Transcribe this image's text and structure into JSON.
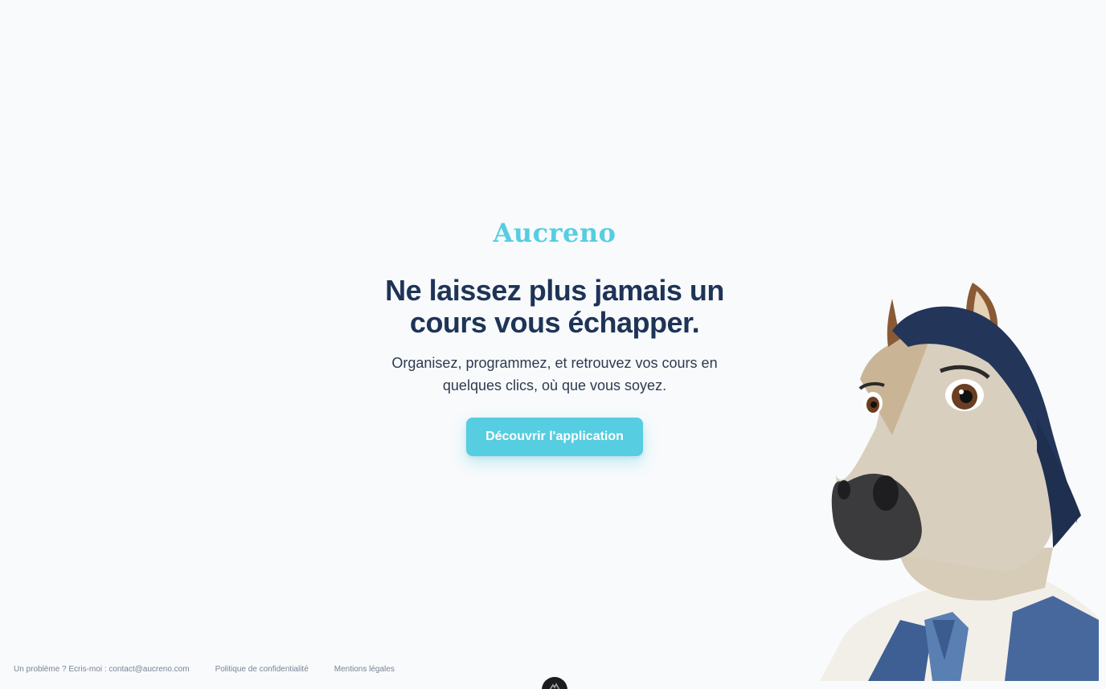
{
  "brand": {
    "name": "Aucreno",
    "color": "#56cde0"
  },
  "hero": {
    "headline": "Ne laissez plus jamais un cours vous échapper.",
    "subline": "Organisez, programmez, et retrouvez vos cours en quelques clics, où que vous soyez.",
    "cta_label": "Découvrir l'application"
  },
  "mascot": {
    "icon": "horse-mascot-illustration"
  },
  "footer": {
    "contact_label": "Un problème ? Ecris-moi : contact@aucreno.com",
    "privacy_label": "Politique de confidentialité",
    "legal_label": "Mentions légales"
  },
  "badge": {
    "icon": "mountain-icon"
  }
}
